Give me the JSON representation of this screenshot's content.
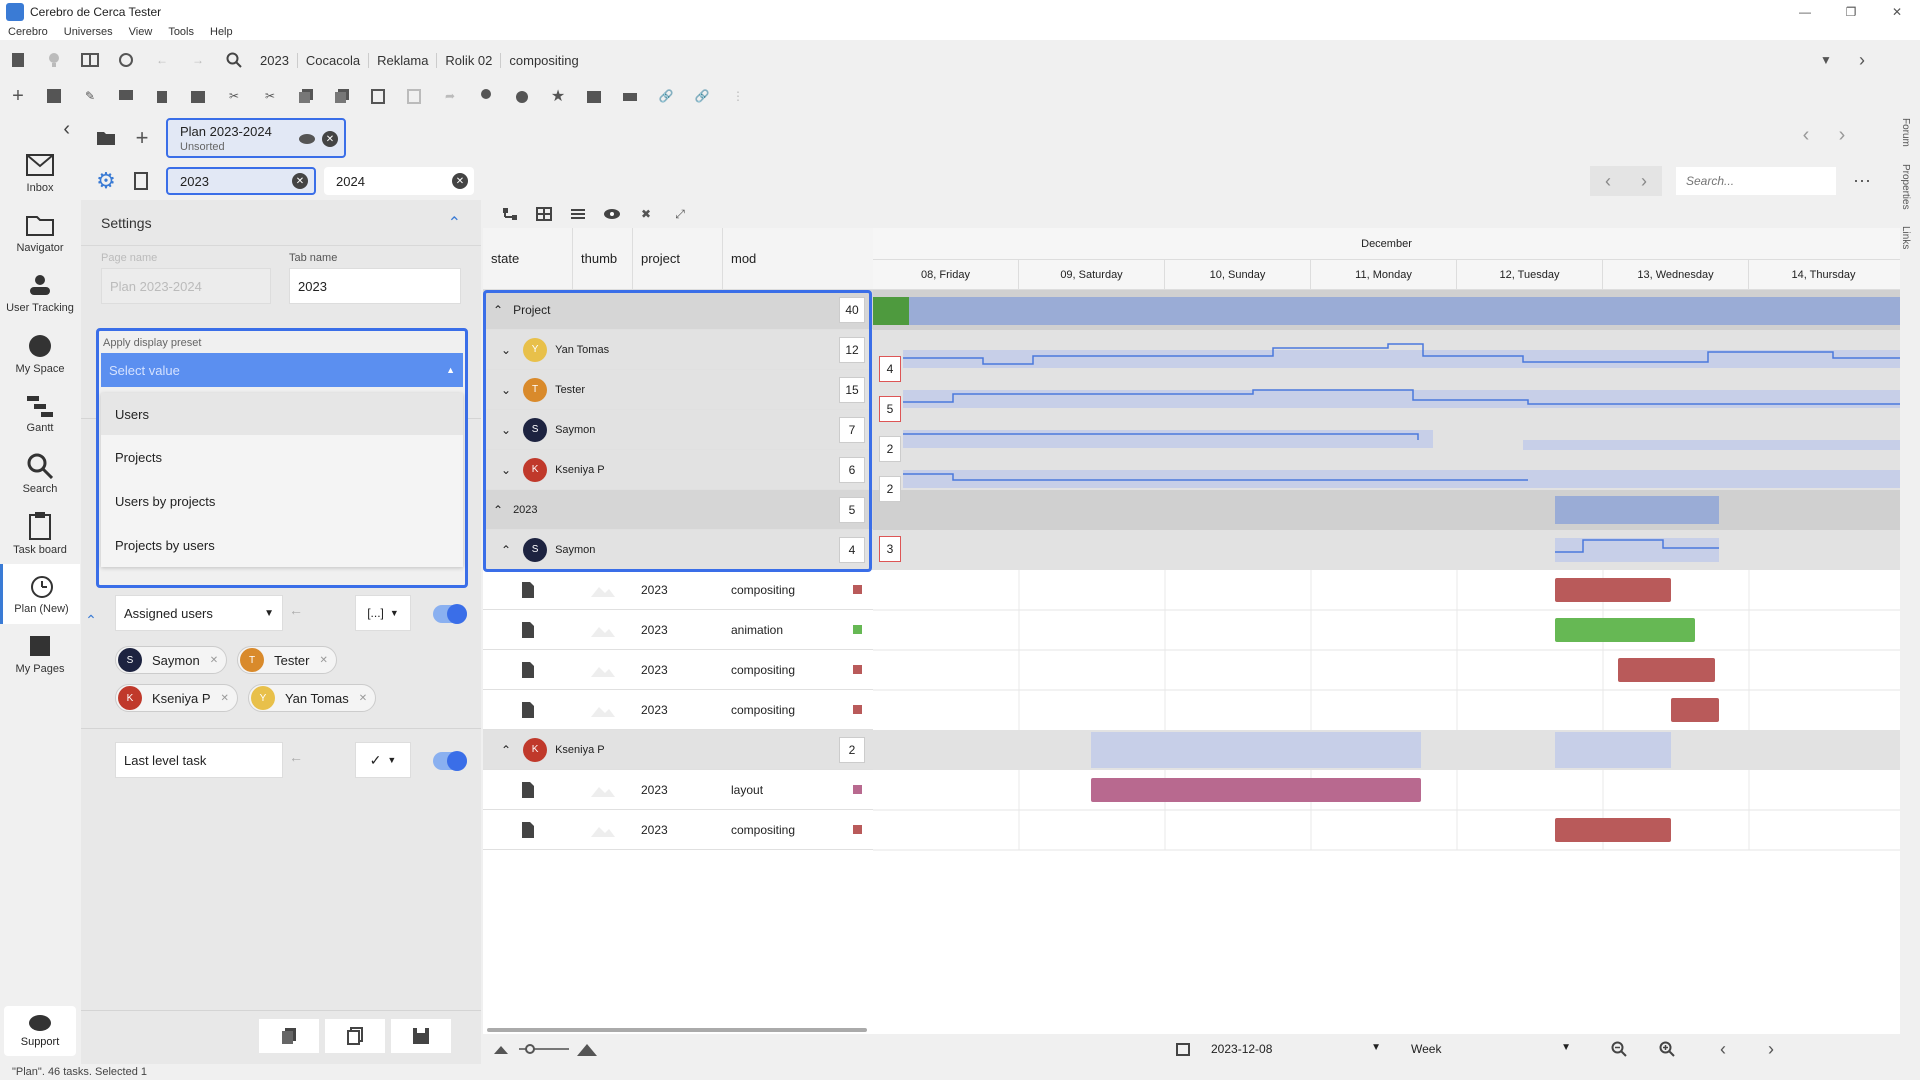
{
  "window": {
    "title": "Cerebro de Cerca  Tester"
  },
  "menu": [
    "Cerebro",
    "Universes",
    "View",
    "Tools",
    "Help"
  ],
  "breadcrumbs": [
    "2023",
    "Cocacola",
    "Reklama",
    "Rolik 02",
    "compositing"
  ],
  "nav": [
    {
      "label": "Inbox",
      "icon": "envelope-icon"
    },
    {
      "label": "Navigator",
      "icon": "folder-icon"
    },
    {
      "label": "User Tracking",
      "icon": "users-icon"
    },
    {
      "label": "My Space",
      "icon": "globe-icon"
    },
    {
      "label": "Gantt",
      "icon": "gantt-icon"
    },
    {
      "label": "Search",
      "icon": "search-icon"
    },
    {
      "label": "Task board",
      "icon": "clipboard-icon"
    },
    {
      "label": "Plan (New)",
      "icon": "plan-icon"
    },
    {
      "label": "My Pages",
      "icon": "pages-icon"
    }
  ],
  "support": {
    "label": "Support"
  },
  "plan_tab": {
    "title": "Plan 2023-2024",
    "subtitle": "Unsorted"
  },
  "filters": {
    "year_a": "2023",
    "year_b": "2024",
    "search_placeholder": "Search..."
  },
  "settings": {
    "title": "Settings",
    "page_name_label": "Page name",
    "page_name_value": "Plan 2023-2024",
    "tab_name_label": "Tab name",
    "tab_name_value": "2023",
    "preset_label": "Apply display preset",
    "preset_placeholder": "Select value",
    "preset_options": [
      "Users",
      "Projects",
      "Users by projects",
      "Projects by users"
    ],
    "assigned_label": "Assigned users",
    "filter_icon_text": "[...]",
    "users": [
      "Saymon",
      "Tester",
      "Kseniya P",
      "Yan Tomas"
    ],
    "last_level_label": "Last level task"
  },
  "columns": [
    "state",
    "thumb",
    "project",
    "mod"
  ],
  "timeline": {
    "month": "December",
    "days": [
      "08, Friday",
      "09, Saturday",
      "10, Sunday",
      "11, Monday",
      "12, Tuesday",
      "13, Wednesday",
      "14, Thursday"
    ]
  },
  "groups": {
    "project": {
      "label": "Project",
      "count": "40"
    },
    "users": [
      {
        "name": "Yan Tomas",
        "count": "12",
        "badge": "4",
        "color": "#e8c04a"
      },
      {
        "name": "Tester",
        "count": "15",
        "badge": "5",
        "color": "#d98a2b"
      },
      {
        "name": "Saymon",
        "count": "7",
        "badge": "2",
        "color": "#1d2340"
      },
      {
        "name": "Kseniya P",
        "count": "6",
        "badge": "2",
        "color": "#c0392b"
      }
    ],
    "year": {
      "label": "2023",
      "count": "5"
    },
    "saymon": {
      "name": "Saymon",
      "count": "4",
      "badge": "3"
    },
    "kseniya": {
      "name": "Kseniya P",
      "count": "2"
    }
  },
  "tasks_saymon": [
    {
      "project": "2023",
      "mod": "compositing",
      "color": "#b95a5a"
    },
    {
      "project": "2023",
      "mod": "animation",
      "color": "#66b854"
    },
    {
      "project": "2023",
      "mod": "compositing",
      "color": "#b95a5a"
    },
    {
      "project": "2023",
      "mod": "compositing",
      "color": "#b95a5a"
    }
  ],
  "tasks_kseniya": [
    {
      "project": "2023",
      "mod": "layout",
      "color": "#b8698f"
    },
    {
      "project": "2023",
      "mod": "compositing",
      "color": "#b95a5a"
    }
  ],
  "bottom": {
    "date": "2023-12-08",
    "scale": "Week"
  },
  "right_tabs": [
    "Forum",
    "Properties",
    "Links"
  ],
  "status": "\"Plan\". 46 tasks. Selected 1"
}
